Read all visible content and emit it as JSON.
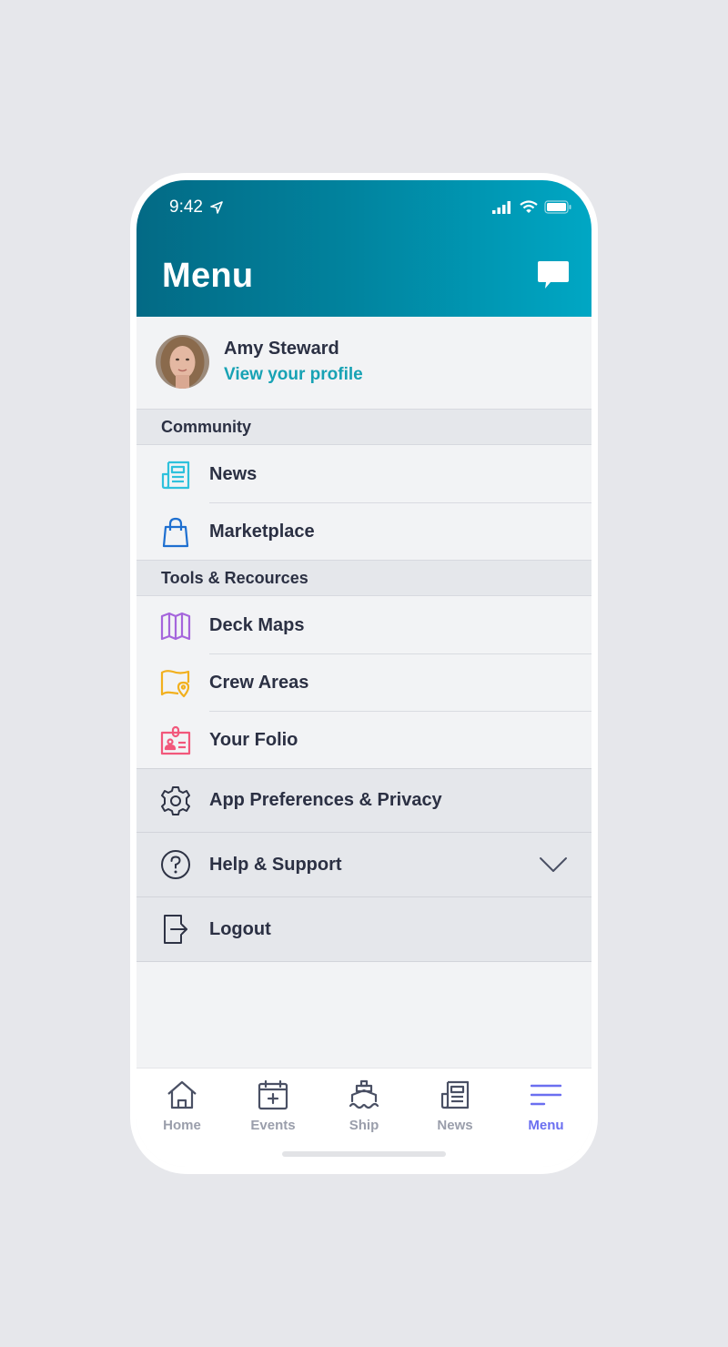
{
  "status_bar": {
    "time": "9:42",
    "location_icon": "location-arrow-icon",
    "signal_icon": "cellular-signal-icon",
    "wifi_icon": "wifi-icon",
    "battery_icon": "battery-icon"
  },
  "header": {
    "title": "Menu",
    "action_icon": "chat-bubble-icon",
    "gradient_start": "#036a85",
    "gradient_end": "#00a7c4"
  },
  "profile": {
    "name": "Amy Steward",
    "link_label": "View your profile",
    "link_color": "#17a2b4"
  },
  "sections": [
    {
      "title": "Community",
      "items": [
        {
          "label": "News",
          "icon": "newspaper-icon",
          "color": "#2fc1dc"
        },
        {
          "label": "Marketplace",
          "icon": "shopping-bag-icon",
          "color": "#1e6fd0"
        }
      ]
    },
    {
      "title": "Tools & Recources",
      "items": [
        {
          "label": "Deck Maps",
          "icon": "map-icon",
          "color": "#a565dc"
        },
        {
          "label": "Crew Areas",
          "icon": "map-pin-icon",
          "color": "#f2b01e"
        },
        {
          "label": "Your Folio",
          "icon": "id-badge-icon",
          "color": "#f2577b"
        }
      ]
    }
  ],
  "settings": [
    {
      "label": "App Preferences & Privacy",
      "icon": "gear-icon"
    },
    {
      "label": "Help & Support",
      "icon": "question-circle-icon",
      "expandable": true,
      "expand_icon": "chevron-down-icon"
    },
    {
      "label": "Logout",
      "icon": "logout-icon"
    }
  ],
  "tabbar": {
    "active": "Menu",
    "active_color": "#6b6ff0",
    "tabs": [
      {
        "label": "Home",
        "icon": "home-icon"
      },
      {
        "label": "Events",
        "icon": "calendar-add-icon"
      },
      {
        "label": "Ship",
        "icon": "ship-icon"
      },
      {
        "label": "News",
        "icon": "newspaper-icon"
      },
      {
        "label": "Menu",
        "icon": "hamburger-menu-icon"
      }
    ]
  }
}
